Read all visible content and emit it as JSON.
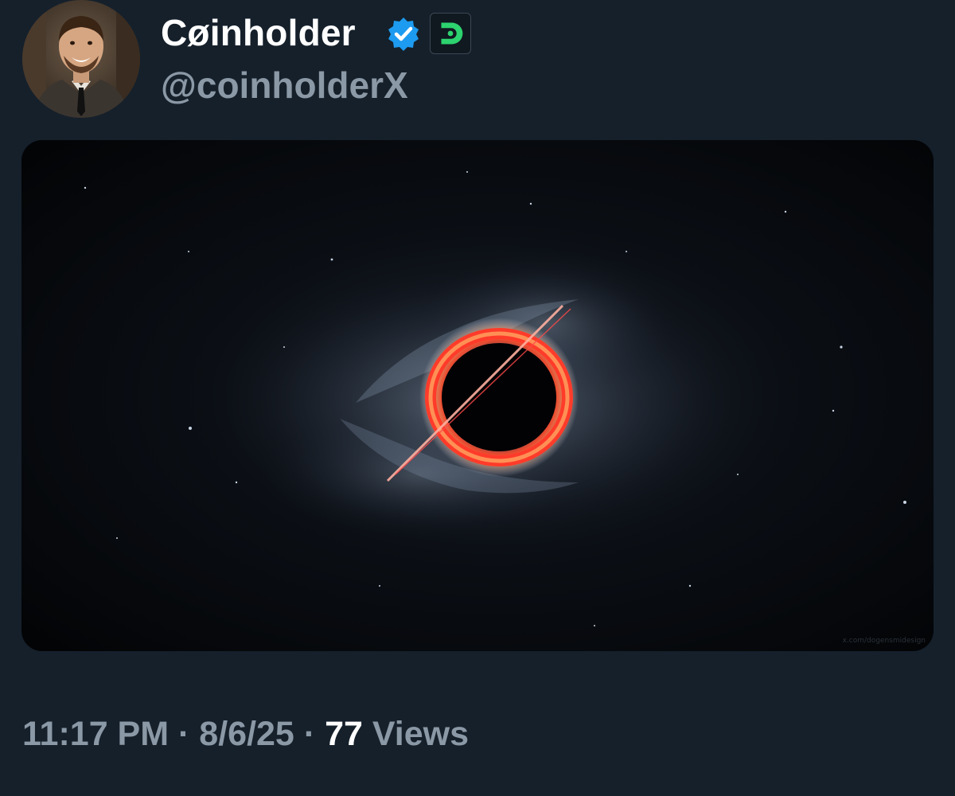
{
  "author": {
    "display_name": "Cøinholder",
    "handle": "@coinholderX",
    "avatar_icon": "profile-photo",
    "verified_icon": "verified-checkmark-icon",
    "affiliate_icon": "green-d-logo-icon"
  },
  "media": {
    "image_icon": "black-hole-ring-image",
    "watermark": "x.com/dogensmidesign"
  },
  "post_meta": {
    "time": "11:17 PM",
    "separator": "·",
    "date": "8/6/25",
    "views_count": "77",
    "views_label": "Views"
  },
  "colors": {
    "background": "#15202b",
    "secondary_text": "#8b98a5",
    "verified_blue": "#1d9bf0",
    "affiliate_green": "#2dd36f"
  }
}
